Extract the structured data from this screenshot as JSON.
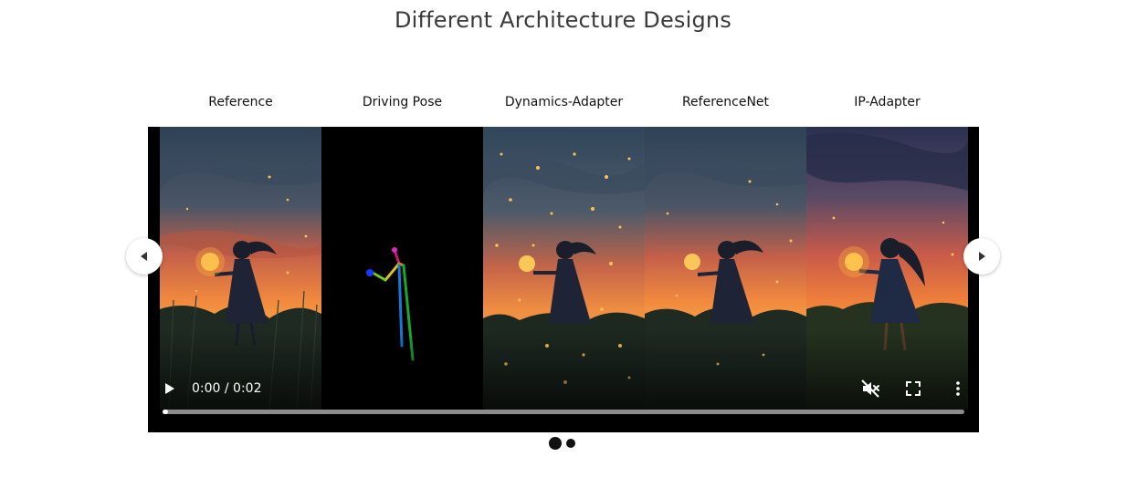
{
  "section": {
    "title": "Different Architecture Designs"
  },
  "columns": [
    {
      "label": "Reference"
    },
    {
      "label": "Driving Pose"
    },
    {
      "label": "Dynamics-Adapter"
    },
    {
      "label": "ReferenceNet"
    },
    {
      "label": "IP-Adapter"
    }
  ],
  "video": {
    "time": "0:00 / 0:02",
    "progress": 0.005,
    "icons": {
      "play": "play-icon",
      "mute": "muted-icon",
      "fullscreen": "fullscreen-icon",
      "menu": "more-vert-icon"
    }
  },
  "carousel": {
    "prev_icon": "chevron-left-icon",
    "next_icon": "chevron-right-icon",
    "slides": 2,
    "active_index": 0
  },
  "colors": {
    "sky_top": "#2e4256",
    "sunset": "#f07a3a",
    "glow": "#ffd25a",
    "grass": "#1f2a22"
  }
}
